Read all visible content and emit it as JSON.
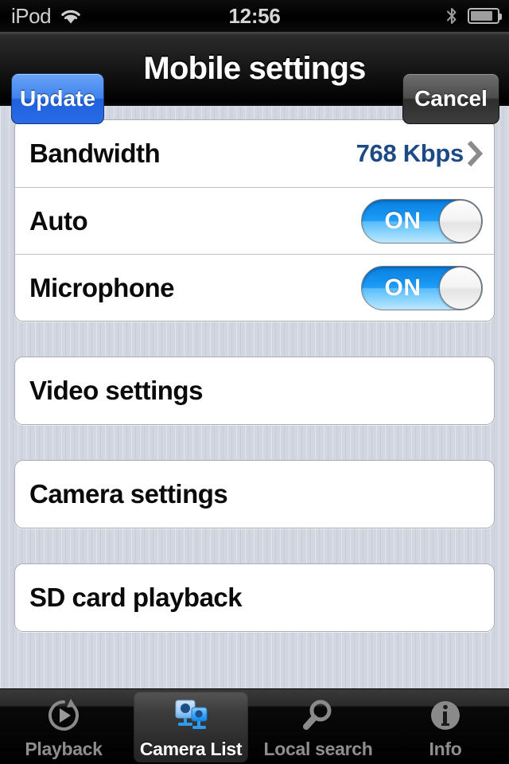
{
  "status_bar": {
    "carrier": "iPod",
    "wifi_icon": "wifi-icon",
    "time": "12:56",
    "bluetooth_icon": "bluetooth-icon",
    "battery_icon": "battery-icon",
    "battery_level_percent": 74
  },
  "nav_bar": {
    "left_button": "Update",
    "title": "Mobile settings",
    "right_button": "Cancel"
  },
  "settings_group": {
    "rows": [
      {
        "label": "Bandwidth",
        "value": "768 Kbps",
        "accessory": "chevron-right-icon"
      },
      {
        "label": "Auto",
        "toggle_state": "ON"
      },
      {
        "label": "Microphone",
        "toggle_state": "ON"
      }
    ]
  },
  "menu_cards": [
    {
      "label": "Video settings"
    },
    {
      "label": "Camera settings"
    },
    {
      "label": "SD card playback"
    }
  ],
  "tab_bar": {
    "tabs": [
      {
        "label": "Playback",
        "icon": "playback-replay-icon",
        "active": false
      },
      {
        "label": "Camera List",
        "icon": "camera-list-icon",
        "active": true
      },
      {
        "label": "Local search",
        "icon": "search-magnifier-icon",
        "active": false
      },
      {
        "label": "Info",
        "icon": "info-circle-icon",
        "active": false
      }
    ]
  },
  "colors": {
    "accent_blue": "#2a6ae6",
    "toggle_blue": "#1593f0",
    "value_blue": "#1d4a84",
    "background": "#d2d6e0",
    "card_white": "#ffffff",
    "tabbar_black": "#000000",
    "active_tab_text": "#ffffff",
    "inactive_tab_text": "#8e8e8e"
  }
}
